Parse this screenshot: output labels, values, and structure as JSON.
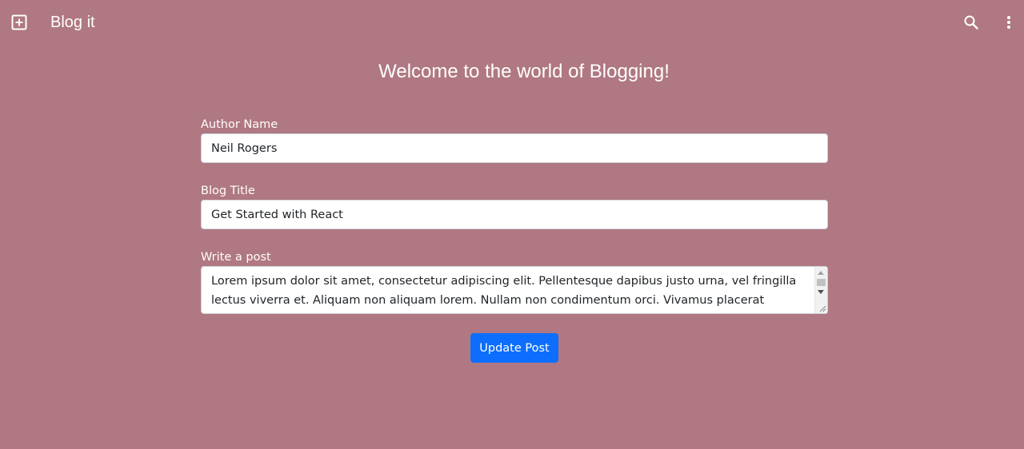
{
  "app_bar": {
    "title": "Blog it",
    "icons": {
      "left": "add-box-icon",
      "search": "search-icon",
      "menu": "more-vert-icon"
    }
  },
  "heading": "Welcome to the world of Blogging!",
  "form": {
    "author": {
      "label": "Author Name",
      "value": "Neil Rogers"
    },
    "title": {
      "label": "Blog Title",
      "value": "Get Started with React"
    },
    "post": {
      "label": "Write a post",
      "value": "Lorem ipsum dolor sit amet, consectetur adipiscing elit. Pellentesque dapibus justo urna, vel fringilla lectus viverra et. Aliquam non aliquam lorem. Nullam non condimentum orci. Vivamus placerat faucibus nisi, quis"
    },
    "submit_label": "Update Post"
  },
  "colors": {
    "background": "#b07882",
    "button": "#0d6efd",
    "text": "#ffffff"
  }
}
